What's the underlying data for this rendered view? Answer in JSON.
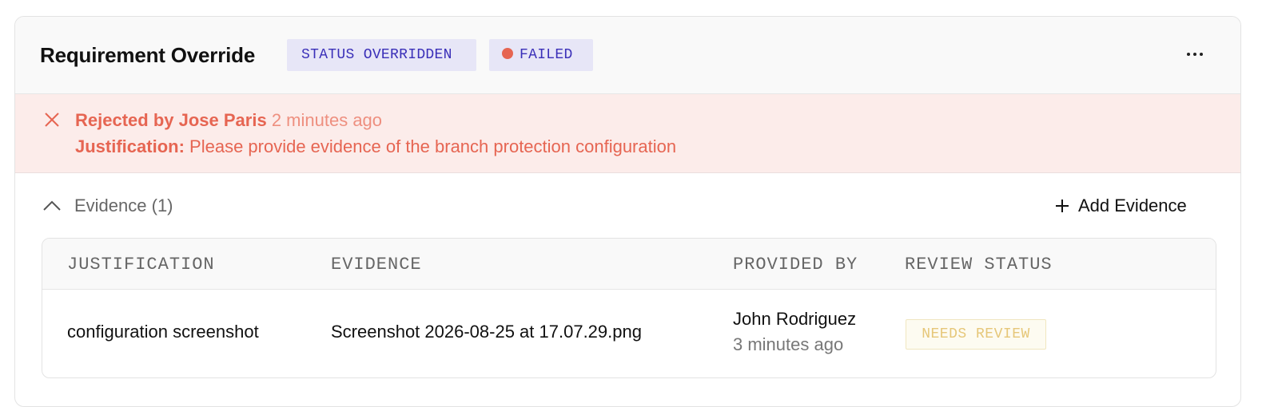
{
  "card": {
    "title": "Requirement Override",
    "badges": {
      "status": "STATUS OVERRIDDEN",
      "result": "FAILED",
      "result_dot_color": "#e66552"
    },
    "more_label": "⋯",
    "more_icon": "more-horizontal-icon"
  },
  "alert": {
    "icon": "close-icon",
    "action_label": "Rejected by",
    "actor": "Jose Paris",
    "time": "2 minutes ago",
    "justification_label": "Justification:",
    "justification_text": "Please provide evidence of the branch protection configuration",
    "color": "#e66552",
    "background": "#fcecea"
  },
  "evidence": {
    "toggle_icon": "chevron-up-icon",
    "label": "Evidence (1)",
    "add_icon": "plus-icon",
    "add_label": "Add Evidence",
    "columns": [
      "JUSTIFICATION",
      "EVIDENCE",
      "PROVIDED BY",
      "REVIEW STATUS"
    ],
    "rows": [
      {
        "justification": "configuration screenshot",
        "evidence": "Screenshot 2026-08-25 at 17.07.29.png",
        "provided_by": "John Rodriguez",
        "provided_time": "3 minutes ago",
        "review_status": "NEEDS REVIEW"
      }
    ]
  },
  "colors": {
    "badge_bg": "#e7e6f7",
    "badge_text": "#3a2fb8",
    "review_text": "#e6c779"
  }
}
